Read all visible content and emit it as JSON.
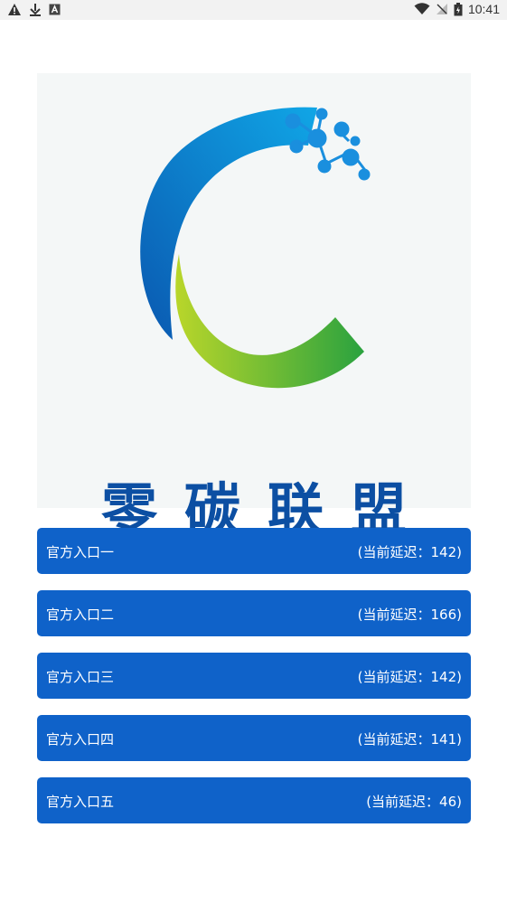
{
  "status_bar": {
    "time": "10:41",
    "left_icons": [
      "warning-icon",
      "download-icon",
      "a-box-icon"
    ],
    "right_icons": [
      "wifi-icon",
      "signal-off-icon",
      "battery-icon"
    ]
  },
  "logo": {
    "text": "零碳联盟",
    "colors": {
      "blue": "#0b6fc6",
      "green": "#43b13a",
      "text": "#0c4fa3"
    }
  },
  "entries": [
    {
      "label": "官方入口一",
      "latency": "(当前延迟：142)"
    },
    {
      "label": "官方入口二",
      "latency": "(当前延迟：166)"
    },
    {
      "label": "官方入口三",
      "latency": "(当前延迟：142)"
    },
    {
      "label": "官方入口四",
      "latency": "(当前延迟：141)"
    },
    {
      "label": "官方入口五",
      "latency": "(当前延迟：46)"
    }
  ],
  "theme": {
    "button_color": "#0f62c9"
  }
}
